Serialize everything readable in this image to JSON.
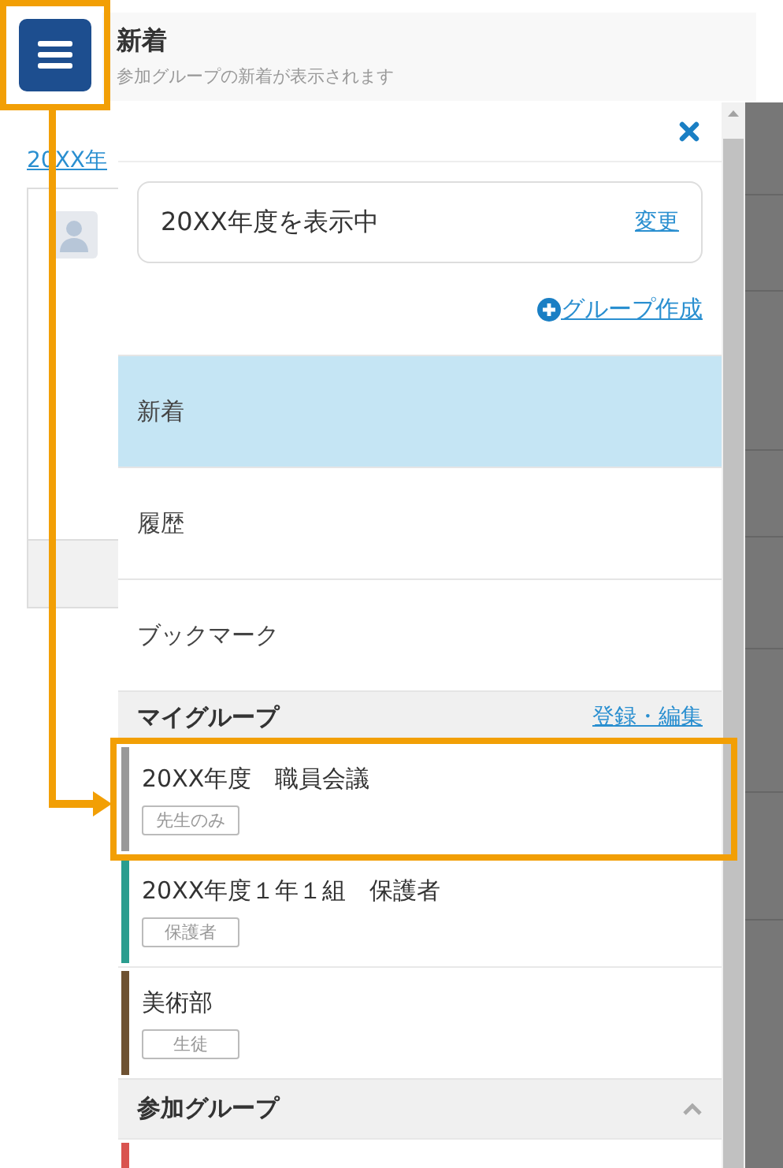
{
  "menu_button": {
    "highlighted": true
  },
  "header": {
    "title": "新着",
    "subtitle": "参加グループの新着が表示されます"
  },
  "background": {
    "link": "20XX年"
  },
  "drawer": {
    "year_box": {
      "text": "20XX年度を表示中",
      "action": "変更"
    },
    "create_group": "グループ作成",
    "nav": [
      {
        "label": "新着",
        "selected": true
      },
      {
        "label": "履歴",
        "selected": false
      },
      {
        "label": "ブックマーク",
        "selected": false
      }
    ],
    "my_groups": {
      "title": "マイグループ",
      "action": "登録・編集",
      "items": [
        {
          "name": "20XX年度　職員会議",
          "tag": "先生のみ",
          "color": "#999999",
          "highlighted": true
        },
        {
          "name": "20XX年度１年１組　保護者",
          "tag": "保護者",
          "color": "#2a9d8f",
          "highlighted": false
        },
        {
          "name": "美術部",
          "tag": "生徒",
          "color": "#6e5232",
          "highlighted": false
        }
      ]
    },
    "joined_groups": {
      "title": "参加グループ",
      "expanded": true,
      "items": [
        {
          "color": "#d9534f"
        }
      ]
    }
  }
}
